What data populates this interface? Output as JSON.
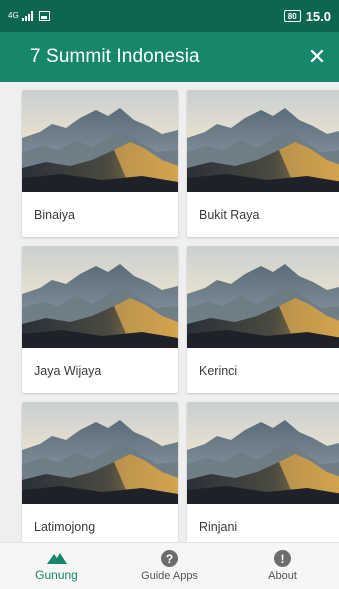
{
  "status": {
    "network": "4G",
    "battery": "80",
    "time": "15.0"
  },
  "appbar": {
    "title": "7 Summit Indonesia",
    "close_symbol": "✕"
  },
  "cards": [
    {
      "name": "Binaiya"
    },
    {
      "name": "Bukit Raya"
    },
    {
      "name": "Jaya Wijaya"
    },
    {
      "name": "Kerinci"
    },
    {
      "name": "Latimojong"
    },
    {
      "name": "Rinjani"
    }
  ],
  "bottom_nav": {
    "items": [
      {
        "label": "Gunung",
        "icon": "mountain-icon",
        "active": true
      },
      {
        "label": "Guide Apps",
        "icon": "help-icon",
        "active": false,
        "glyph": "?"
      },
      {
        "label": "About",
        "icon": "info-icon",
        "active": false,
        "glyph": "!"
      }
    ]
  },
  "colors": {
    "status_bar": "#0c6650",
    "app_bar": "#17876c",
    "accent": "#17876c"
  }
}
